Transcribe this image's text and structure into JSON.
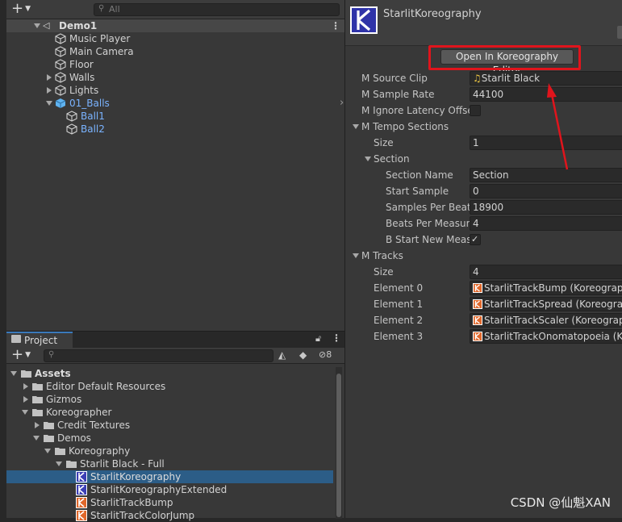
{
  "hierarchy": {
    "add_symbol": "+",
    "search_placeholder": "All",
    "scene": "Demo1",
    "items": [
      {
        "label": "Music Player"
      },
      {
        "label": "Main Camera"
      },
      {
        "label": "Floor"
      },
      {
        "label": "Walls"
      },
      {
        "label": "Lights"
      },
      {
        "label": "01_Balls"
      },
      {
        "label": "Ball1"
      },
      {
        "label": "Ball2"
      }
    ]
  },
  "project": {
    "tab_label": "Project",
    "hidden_count": "8",
    "tree": [
      {
        "label": "Assets"
      },
      {
        "label": "Editor Default Resources"
      },
      {
        "label": "Gizmos"
      },
      {
        "label": "Koreographer"
      },
      {
        "label": "Credit Textures"
      },
      {
        "label": "Demos"
      },
      {
        "label": "Koreography"
      },
      {
        "label": "Starlit Black - Full"
      },
      {
        "label": "StarlitKoreography"
      },
      {
        "label": "StarlitKoreographyExtended"
      },
      {
        "label": "StarlitTrackBump"
      },
      {
        "label": "StarlitTrackColorJump"
      }
    ]
  },
  "inspector": {
    "object_name": "StarlitKoreography",
    "open_button": "Open In Koreography Editor",
    "properties": {
      "source_clip_label": "M Source Clip",
      "source_clip_value": "Starlit Black",
      "sample_rate_label": "M Sample Rate",
      "sample_rate_value": "44100",
      "ignore_latency_label": "M Ignore Latency Offset",
      "tempo_sections_label": "M Tempo Sections",
      "tempo_size_label": "Size",
      "tempo_size_value": "1",
      "section_label": "Section",
      "section_name_label": "Section Name",
      "section_name_value": "Section",
      "start_sample_label": "Start Sample",
      "start_sample_value": "0",
      "samples_per_beat_label": "Samples Per Beat",
      "samples_per_beat_value": "18900",
      "beats_per_measure_label": "Beats Per Measure",
      "beats_per_measure_value": "4",
      "start_new_measure_label": "B Start New Measure",
      "tracks_label": "M Tracks",
      "tracks_size_label": "Size",
      "tracks_size_value": "4",
      "elements": [
        {
          "label": "Element 0",
          "value": "StarlitTrackBump (Koreography Track)"
        },
        {
          "label": "Element 1",
          "value": "StarlitTrackSpread (Koreography Track)"
        },
        {
          "label": "Element 2",
          "value": "StarlitTrackScaler (Koreography Track)"
        },
        {
          "label": "Element 3",
          "value": "StarlitTrackOnomatopoeia (Koreography Track)"
        }
      ]
    }
  },
  "watermark": "CSDN @仙魁XAN",
  "colors": {
    "highlight": "#e0141c",
    "selection": "#2c5d87",
    "link_blue": "#7ab3ff"
  }
}
